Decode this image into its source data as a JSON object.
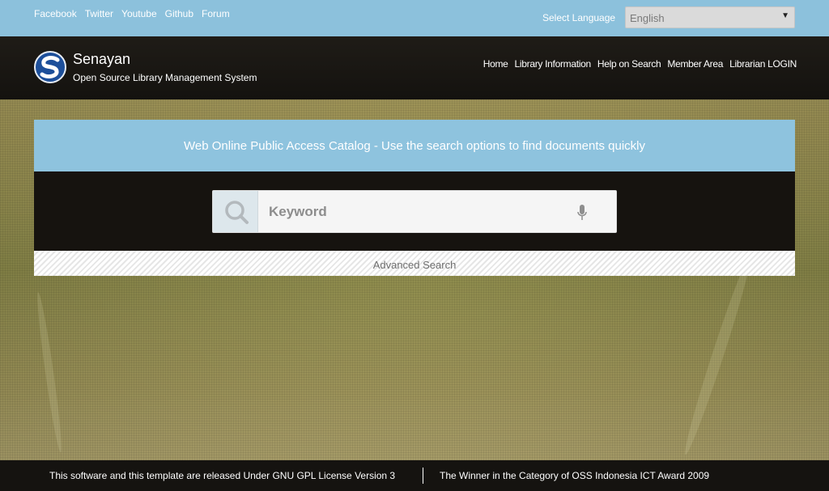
{
  "topbar": {
    "social_links": [
      "Facebook",
      "Twitter",
      "Youtube",
      "Github",
      "Forum"
    ],
    "language_label": "Select Language",
    "language_value": "English",
    "color": "#8cc1dc"
  },
  "header": {
    "site_name": "Senayan",
    "site_subtitle": "Open Source Library Management System",
    "nav": [
      "Home",
      "Library Information",
      "Help on Search",
      "Member Area",
      "Librarian LOGIN"
    ],
    "logo_icon": "senayan-logo"
  },
  "search": {
    "banner_text": "Web Online Public Access Catalog - Use the search options to find documents quickly",
    "placeholder": "Keyword",
    "value": "",
    "search_icon": "search-icon",
    "mic_icon": "microphone-icon",
    "advanced_label": "Advanced Search",
    "banner_color": "#8ec3de"
  },
  "footer": {
    "license_text": "This software and this template are released Under GNU GPL License Version 3",
    "award_text": "The Winner in the Category of OSS Indonesia ICT Award 2009"
  }
}
